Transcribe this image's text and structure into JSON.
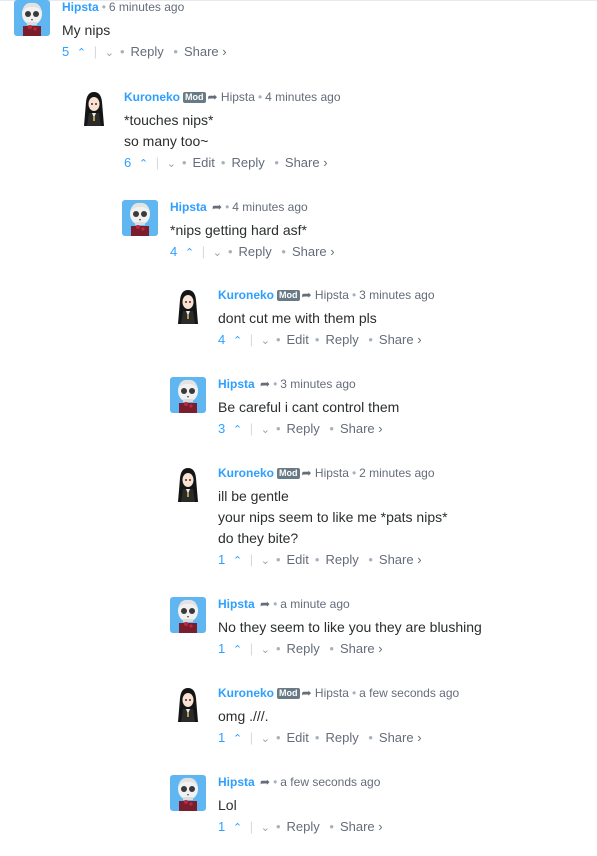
{
  "comments": [
    {
      "author": "Hipsta",
      "avatar": "skull-avatar",
      "mod": "",
      "parent": "",
      "time": "6 minutes ago",
      "lines": [
        "My nips"
      ],
      "votes": "5",
      "edit": "",
      "reply": "Reply",
      "share": "Share ›"
    },
    {
      "author": "Kuroneko",
      "avatar": "anime-girl-avatar",
      "mod": "Mod",
      "parent": "Hipsta",
      "time": "4 minutes ago",
      "lines": [
        "*touches nips*",
        "so many too~"
      ],
      "votes": "6",
      "edit": "Edit",
      "reply": "Reply",
      "share": "Share ›"
    },
    {
      "author": "Hipsta",
      "avatar": "skull-avatar",
      "mod": "",
      "parent": "",
      "time": "4 minutes ago",
      "lines": [
        "*nips getting hard asf*"
      ],
      "votes": "4",
      "edit": "",
      "reply": "Reply",
      "share": "Share ›"
    },
    {
      "author": "Kuroneko",
      "avatar": "anime-girl-avatar",
      "mod": "Mod",
      "parent": "Hipsta",
      "time": "3 minutes ago",
      "lines": [
        "dont cut me with them pls"
      ],
      "votes": "4",
      "edit": "Edit",
      "reply": "Reply",
      "share": "Share ›"
    },
    {
      "author": "Hipsta",
      "avatar": "skull-avatar",
      "mod": "",
      "parent": "",
      "time": "3 minutes ago",
      "lines": [
        "Be careful i cant control them"
      ],
      "votes": "3",
      "edit": "",
      "reply": "Reply",
      "share": "Share ›"
    },
    {
      "author": "Kuroneko",
      "avatar": "anime-girl-avatar",
      "mod": "Mod",
      "parent": "Hipsta",
      "time": "2 minutes ago",
      "lines": [
        "ill be gentle",
        "your nips seem to like me *pats nips*",
        "do they bite?"
      ],
      "votes": "1",
      "edit": "Edit",
      "reply": "Reply",
      "share": "Share ›"
    },
    {
      "author": "Hipsta",
      "avatar": "skull-avatar",
      "mod": "",
      "parent": "",
      "time": "a minute ago",
      "lines": [
        "No they seem to like you they are blushing"
      ],
      "votes": "1",
      "edit": "",
      "reply": "Reply",
      "share": "Share ›"
    },
    {
      "author": "Kuroneko",
      "avatar": "anime-girl-avatar",
      "mod": "Mod",
      "parent": "Hipsta",
      "time": "a few seconds ago",
      "lines": [
        "omg .///."
      ],
      "votes": "1",
      "edit": "Edit",
      "reply": "Reply",
      "share": "Share ›"
    },
    {
      "author": "Hipsta",
      "avatar": "skull-avatar",
      "mod": "",
      "parent": "",
      "time": "a few seconds ago",
      "lines": [
        "Lol"
      ],
      "votes": "1",
      "edit": "",
      "reply": "Reply",
      "share": "Share ›"
    }
  ],
  "glyphs": {
    "upvote": "⌃",
    "downvote": "⌄",
    "reply_arrow": "➦",
    "separator": "•",
    "divider": "|"
  },
  "colors": {
    "author": "#2e9fff",
    "mod_badge": "#687a86",
    "meta": "#656c7a",
    "text": "#2a2e2e"
  }
}
